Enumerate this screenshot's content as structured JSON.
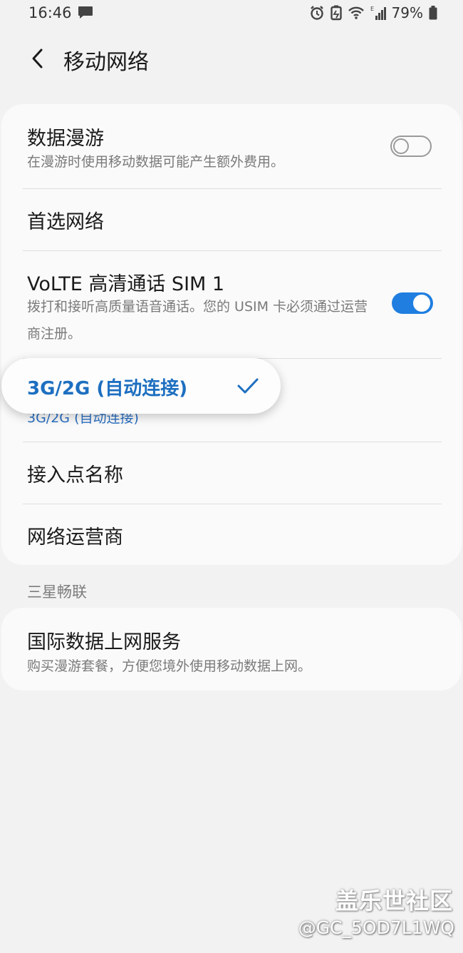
{
  "status": {
    "time": "16:46",
    "battery": "79%"
  },
  "header": {
    "title": "移动网络"
  },
  "settings": {
    "data_roaming": {
      "title": "数据漫游",
      "subtitle": "在漫游时使用移动数据可能产生额外费用。",
      "enabled": false
    },
    "preferred_network": {
      "title": "首选网络"
    },
    "volte": {
      "title": "VoLTE 高清通话 SIM 1",
      "subtitle": "拨打和接听高质量语音通话。您的 USIM 卡必须通过运营商注册。",
      "enabled": true
    },
    "network_mode": {
      "value": "3G/2G (自动连接)"
    },
    "apn": {
      "title": "接入点名称"
    },
    "operator": {
      "title": "网络运营商"
    }
  },
  "popup": {
    "option_label": "3G/2G (自动连接)",
    "selected": true
  },
  "section": {
    "label": "三星畅联"
  },
  "samsung_connect": {
    "title": "国际数据上网服务",
    "subtitle": "购买漫游套餐，方便您境外使用移动数据上网。"
  },
  "watermark": {
    "site": "盖乐世社区",
    "user": "@GC_5OD7L1WQ"
  },
  "colors": {
    "accent": "#1f7ee0",
    "background": "#f2f2f2",
    "card": "#fafafa"
  }
}
